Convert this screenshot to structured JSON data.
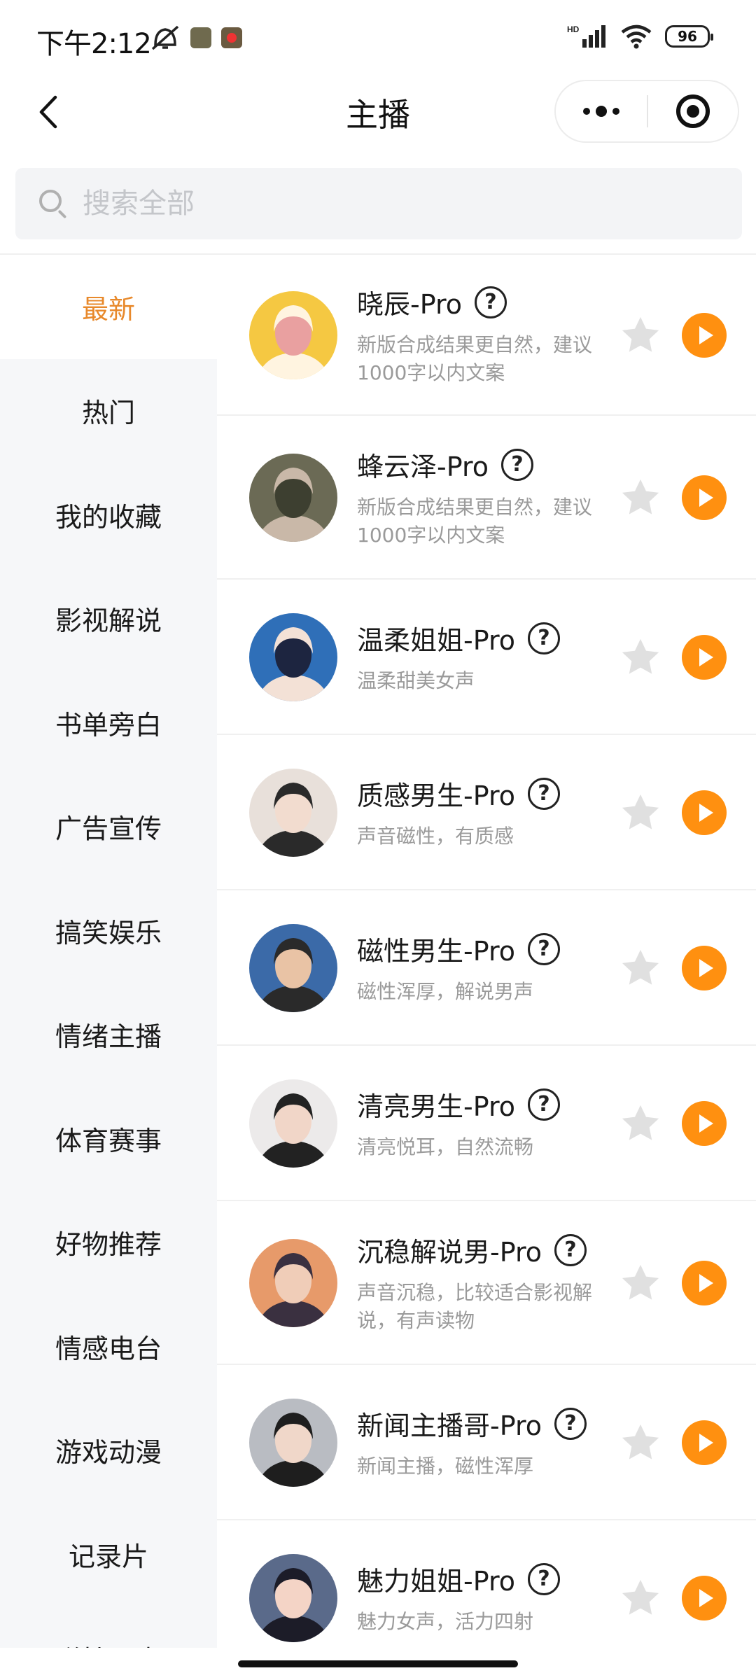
{
  "status_bar": {
    "time": "下午2:12",
    "battery": "96",
    "signal": "HD"
  },
  "nav": {
    "title": "主播"
  },
  "search": {
    "placeholder": "搜索全部"
  },
  "sidebar": {
    "items": [
      {
        "label": "最新",
        "active": true
      },
      {
        "label": "热门"
      },
      {
        "label": "我的收藏"
      },
      {
        "label": "影视解说"
      },
      {
        "label": "书单旁白"
      },
      {
        "label": "广告宣传"
      },
      {
        "label": "搞笑娱乐"
      },
      {
        "label": "情绪主播"
      },
      {
        "label": "体育赛事"
      },
      {
        "label": "好物推荐"
      },
      {
        "label": "情感电台"
      },
      {
        "label": "游戏动漫"
      },
      {
        "label": "记录片"
      },
      {
        "label": "磁性男声"
      }
    ]
  },
  "anchors": [
    {
      "name": "晓辰-Pro",
      "desc": "新版合成结果更自然，建议1000字以内文案",
      "help": "?",
      "colors": [
        "#f5c842",
        "#fff4e0",
        "#e9a0a0"
      ]
    },
    {
      "name": "蜂云泽-Pro",
      "desc": "新版合成结果更自然，建议1000字以内文案",
      "help": "?",
      "colors": [
        "#6b6a55",
        "#c9b8a8",
        "#3d3f30"
      ]
    },
    {
      "name": "温柔姐姐-Pro",
      "desc": "温柔甜美女声",
      "help": "?",
      "colors": [
        "#2f6fb8",
        "#f3e1d6",
        "#1d2540"
      ]
    },
    {
      "name": "质感男生-Pro",
      "desc": "声音磁性，有质感",
      "help": "?",
      "colors": [
        "#e8e0da",
        "#2a2a2a",
        "#f2dccf"
      ]
    },
    {
      "name": "磁性男生-Pro",
      "desc": "磁性浑厚，解说男声",
      "help": "?",
      "colors": [
        "#3b6aa8",
        "#2a2a2a",
        "#e9c3a5"
      ]
    },
    {
      "name": "清亮男生-Pro",
      "desc": "清亮悦耳，自然流畅",
      "help": "?",
      "colors": [
        "#eceaea",
        "#222222",
        "#f1d6c8"
      ]
    },
    {
      "name": "沉稳解说男-Pro",
      "desc": "声音沉稳，比较适合影视解说，有声读物",
      "help": "?",
      "colors": [
        "#e79a6a",
        "#3a3040",
        "#f0cdb8"
      ]
    },
    {
      "name": "新闻主播哥-Pro",
      "desc": "新闻主播，磁性浑厚",
      "help": "?",
      "colors": [
        "#b9bcc2",
        "#1e1e1e",
        "#f0d7c9"
      ]
    },
    {
      "name": "魅力姐姐-Pro",
      "desc": "魅力女声，活力四射",
      "help": "?",
      "colors": [
        "#5a6a8a",
        "#1c1c28",
        "#f4d4c6"
      ]
    }
  ],
  "theme": {
    "accent": "#ff9010",
    "active_text": "#e8892b",
    "star": "#e0e0e0"
  }
}
